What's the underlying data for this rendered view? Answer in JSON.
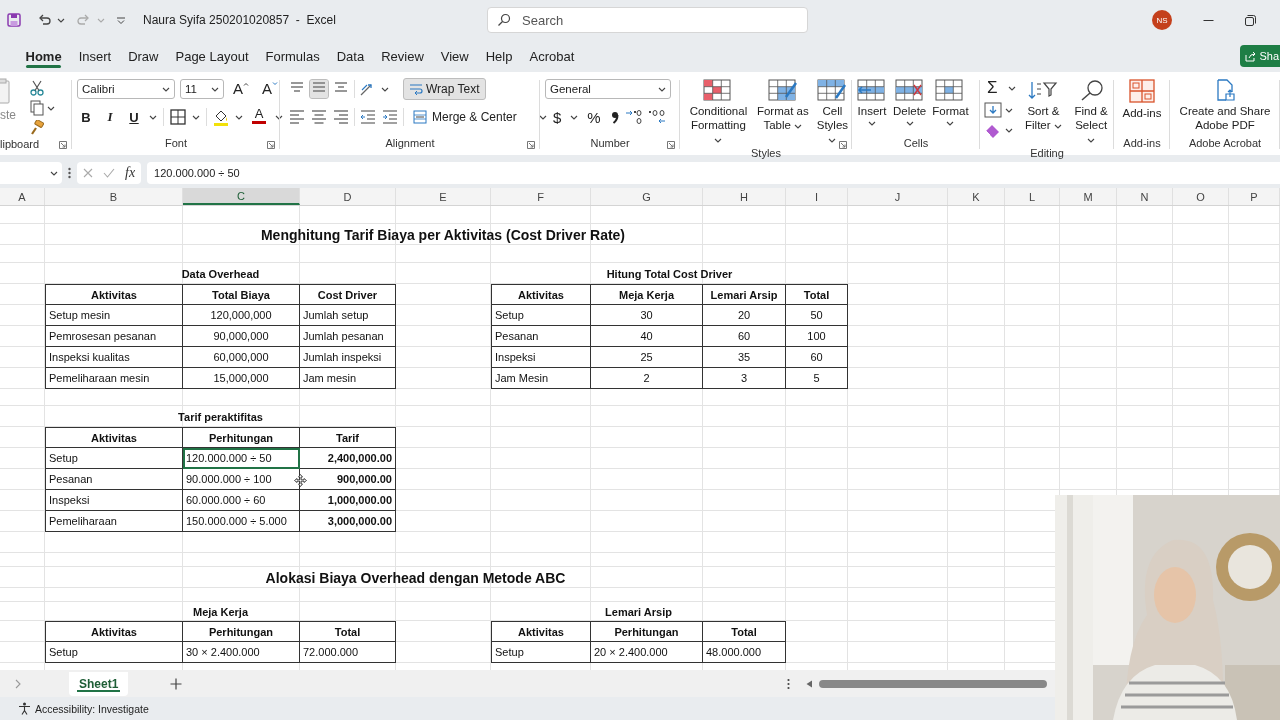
{
  "title_bar": {
    "document_title": "Naura Syifa 250201020857  -  Excel",
    "search_placeholder": "Search",
    "account_initials": "NS"
  },
  "ribbon_tabs": [
    {
      "label": "Home",
      "selected": true
    },
    {
      "label": "Insert",
      "selected": false
    },
    {
      "label": "Draw",
      "selected": false
    },
    {
      "label": "Page Layout",
      "selected": false
    },
    {
      "label": "Formulas",
      "selected": false
    },
    {
      "label": "Data",
      "selected": false
    },
    {
      "label": "Review",
      "selected": false
    },
    {
      "label": "View",
      "selected": false
    },
    {
      "label": "Help",
      "selected": false
    },
    {
      "label": "Acrobat",
      "selected": false
    }
  ],
  "share_button": {
    "label": "Sha"
  },
  "ribbon": {
    "groups": [
      {
        "kind": "clipboard",
        "label": "lipboard",
        "paste_label": "ste"
      },
      {
        "kind": "font",
        "label": "Font",
        "font_name": "Calibri",
        "font_size": "11",
        "size_step_buttons": [
          "A",
          "A"
        ],
        "style_buttons": [
          "B",
          "I",
          "U"
        ],
        "font_color_label": "A"
      },
      {
        "kind": "alignment",
        "label": "Alignment",
        "vertical_align": [
          {
            "selected": false
          },
          {
            "selected": true
          },
          {
            "selected": false
          }
        ],
        "wrap_text": {
          "label": "Wrap Text",
          "on": true
        },
        "merge_label": "Merge & Center"
      },
      {
        "kind": "number",
        "label": "Number",
        "format": "General",
        "symbols": [
          "$",
          "%"
        ]
      },
      {
        "kind": "styles",
        "label": "Styles",
        "buttons": [
          "Conditional Formatting",
          "Format as Table",
          "Cell Styles"
        ]
      },
      {
        "kind": "cells",
        "label": "Cells",
        "buttons": [
          "Insert",
          "Delete",
          "Format"
        ]
      },
      {
        "kind": "editing",
        "label": "Editing",
        "autosum_symbol": "Σ",
        "buttons": [
          "Sort & Filter",
          "Find & Select"
        ]
      },
      {
        "kind": "addins",
        "label": "Add-ins",
        "buttons": [
          "Add-ins"
        ]
      },
      {
        "kind": "acrobat",
        "label": "Adobe Acrobat",
        "buttons": [
          "Create and Share Adobe PDF"
        ]
      }
    ]
  },
  "formula_bar": {
    "function_label": "fx",
    "value": "120.000.000 ÷ 50"
  },
  "columns": [
    {
      "label": "A",
      "selected": false
    },
    {
      "label": "B",
      "selected": false
    },
    {
      "label": "C",
      "selected": true
    },
    {
      "label": "D",
      "selected": false
    },
    {
      "label": "E",
      "selected": false
    },
    {
      "label": "F",
      "selected": false
    },
    {
      "label": "G",
      "selected": false
    },
    {
      "label": "H",
      "selected": false
    },
    {
      "label": "I",
      "selected": false
    },
    {
      "label": "J",
      "selected": false
    },
    {
      "label": "K",
      "selected": false
    },
    {
      "label": "L",
      "selected": false
    },
    {
      "label": "M",
      "selected": false
    },
    {
      "label": "N",
      "selected": false
    },
    {
      "label": "O",
      "selected": false
    },
    {
      "label": "P",
      "selected": false
    }
  ],
  "sheet": {
    "headings": [
      "Menghitung Tarif Biaya per Aktivitas (Cost Driver Rate)",
      "Alokasi Biaya Overhead dengan Metode ABC"
    ],
    "tables": [
      {
        "title": "Data Overhead",
        "columns": [
          "Aktivitas",
          "Total Biaya",
          "Cost Driver"
        ],
        "rows": [
          [
            {
              "text": "Setup mesin",
              "selected": false
            },
            {
              "text": "120,000,000",
              "selected": false
            },
            {
              "text": "Jumlah setup",
              "selected": false
            }
          ],
          [
            {
              "text": "Pemrosesan pesanan",
              "selected": false
            },
            {
              "text": "90,000,000",
              "selected": false
            },
            {
              "text": "Jumlah pesanan",
              "selected": false
            }
          ],
          [
            {
              "text": "Inspeksi kualitas",
              "selected": false
            },
            {
              "text": "60,000,000",
              "selected": false
            },
            {
              "text": "Jumlah inspeksi",
              "selected": false
            }
          ],
          [
            {
              "text": "Pemeliharaan mesin",
              "selected": false
            },
            {
              "text": "15,000,000",
              "selected": false
            },
            {
              "text": "Jam mesin",
              "selected": false
            }
          ]
        ]
      },
      {
        "title": "Hitung Total Cost Driver",
        "columns": [
          "Aktivitas",
          "Meja Kerja",
          "Lemari Arsip",
          "Total"
        ],
        "rows": [
          [
            {
              "text": "Setup",
              "selected": false
            },
            {
              "text": "30",
              "selected": false
            },
            {
              "text": "20",
              "selected": false
            },
            {
              "text": "50",
              "selected": false
            }
          ],
          [
            {
              "text": "Pesanan",
              "selected": false
            },
            {
              "text": "40",
              "selected": false
            },
            {
              "text": "60",
              "selected": false
            },
            {
              "text": "100",
              "selected": false
            }
          ],
          [
            {
              "text": "Inspeksi",
              "selected": false
            },
            {
              "text": "25",
              "selected": false
            },
            {
              "text": "35",
              "selected": false
            },
            {
              "text": "60",
              "selected": false
            }
          ],
          [
            {
              "text": "Jam Mesin",
              "selected": false
            },
            {
              "text": "2",
              "selected": false
            },
            {
              "text": "3",
              "selected": false
            },
            {
              "text": "5",
              "selected": false
            }
          ]
        ]
      },
      {
        "title": "Tarif peraktifitas",
        "columns": [
          "Aktivitas",
          "Perhitungan",
          "Tarif"
        ],
        "rows": [
          [
            {
              "text": "Setup",
              "selected": false
            },
            {
              "text": "120.000.000 ÷ 50",
              "selected": true
            },
            {
              "text": "2,400,000.00",
              "selected": false
            }
          ],
          [
            {
              "text": "Pesanan",
              "selected": false
            },
            {
              "text": "90.000.000 ÷ 100",
              "selected": false
            },
            {
              "text": "900,000.00",
              "selected": false
            }
          ],
          [
            {
              "text": "Inspeksi",
              "selected": false
            },
            {
              "text": "60.000.000 ÷ 60",
              "selected": false
            },
            {
              "text": "1,000,000.00",
              "selected": false
            }
          ],
          [
            {
              "text": "Pemeliharaan",
              "selected": false
            },
            {
              "text": "150.000.000 ÷ 5.000",
              "selected": false
            },
            {
              "text": "3,000,000.00",
              "selected": false
            }
          ]
        ]
      },
      {
        "title": "Meja Kerja",
        "columns": [
          "Aktivitas",
          "Perhitungan",
          "Total"
        ],
        "rows": [
          [
            {
              "text": "Setup",
              "selected": false
            },
            {
              "text": "30 × 2.400.000",
              "selected": false
            },
            {
              "text": "72.000.000",
              "selected": false
            }
          ]
        ]
      },
      {
        "title": "Lemari Arsip",
        "columns": [
          "Aktivitas",
          "Perhitungan",
          "Total"
        ],
        "rows": [
          [
            {
              "text": "Setup",
              "selected": false
            },
            {
              "text": "20 × 2.400.000",
              "selected": false
            },
            {
              "text": "48.000.000",
              "selected": false
            }
          ]
        ]
      }
    ]
  },
  "sheet_tabs": [
    {
      "label": "Sheet1",
      "selected": true
    }
  ],
  "status_bar": {
    "accessibility": "Accessibility: Investigate"
  }
}
